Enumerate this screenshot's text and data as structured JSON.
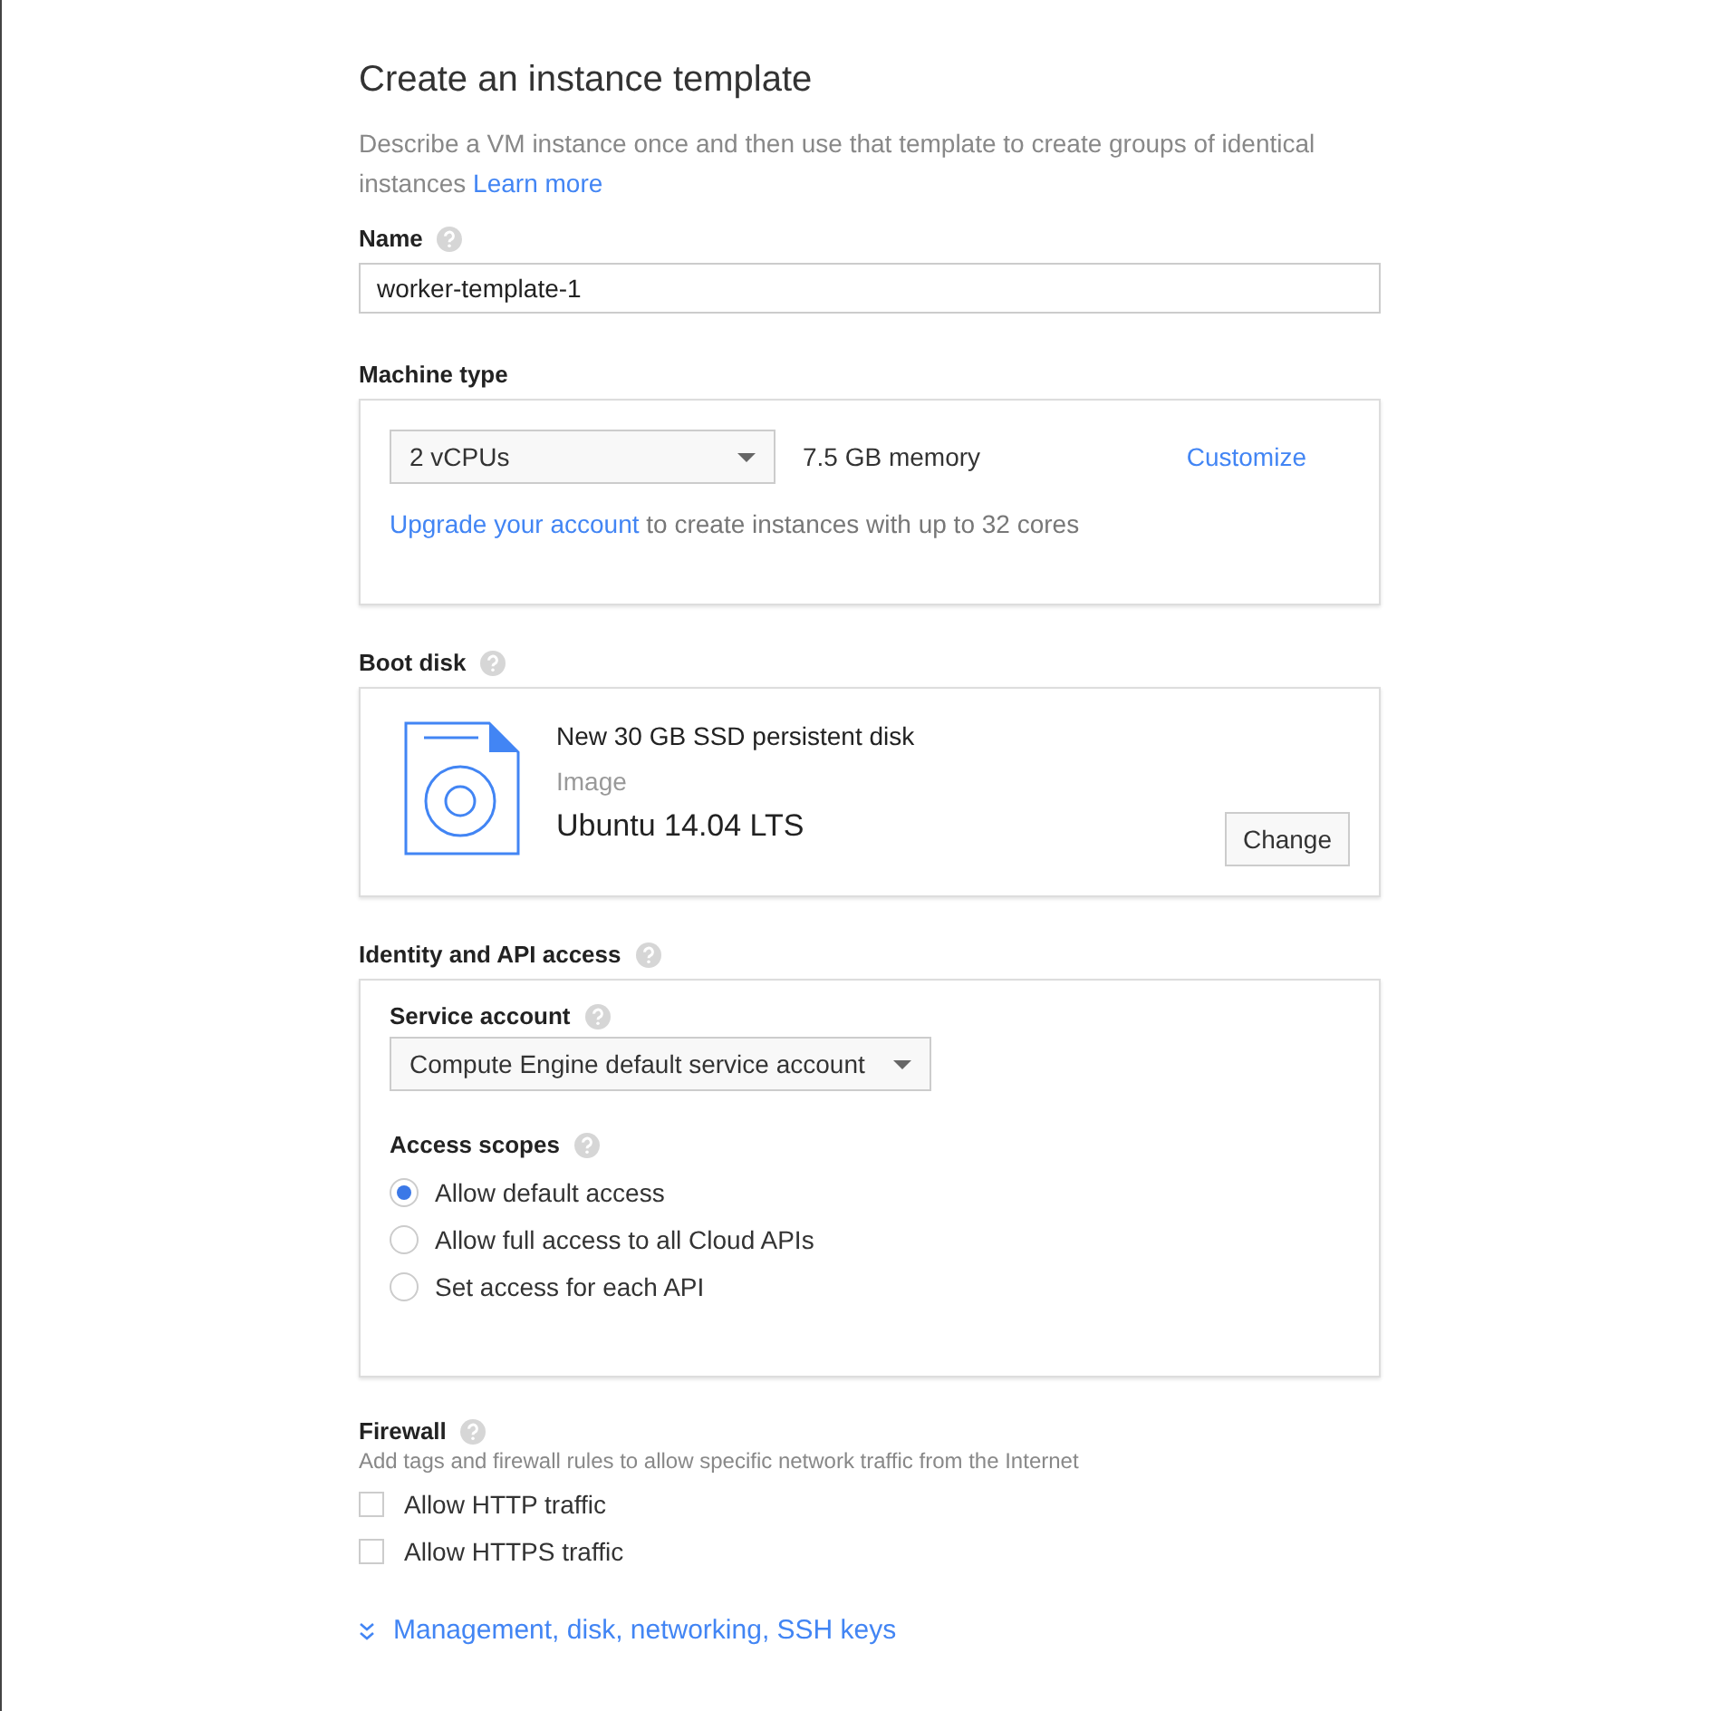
{
  "page": {
    "title": "Create an instance template",
    "description": "Describe a VM instance once and then use that template to create groups of identical instances",
    "learn_more": "Learn more"
  },
  "name": {
    "label": "Name",
    "value": "worker-template-1"
  },
  "machine_type": {
    "label": "Machine type",
    "cpus": "2 vCPUs",
    "memory": "7.5 GB memory",
    "customize": "Customize",
    "upgrade_link": "Upgrade your account",
    "upgrade_text": "to create instances with up to 32 cores"
  },
  "boot_disk": {
    "label": "Boot disk",
    "disk": "New 30 GB SSD persistent disk",
    "image_label": "Image",
    "image": "Ubuntu 14.04 LTS",
    "change": "Change"
  },
  "identity": {
    "label": "Identity and API access",
    "service_account_label": "Service account",
    "service_account": "Compute Engine default service account",
    "scopes_label": "Access scopes",
    "scopes": [
      {
        "label": "Allow default access",
        "selected": true
      },
      {
        "label": "Allow full access to all Cloud APIs",
        "selected": false
      },
      {
        "label": "Set access for each API",
        "selected": false
      }
    ]
  },
  "firewall": {
    "label": "Firewall",
    "description": "Add tags and firewall rules to allow specific network traffic from the Internet",
    "options": [
      {
        "label": "Allow HTTP traffic",
        "checked": false
      },
      {
        "label": "Allow HTTPS traffic",
        "checked": false
      }
    ]
  },
  "more_link": "Management, disk, networking, SSH keys"
}
